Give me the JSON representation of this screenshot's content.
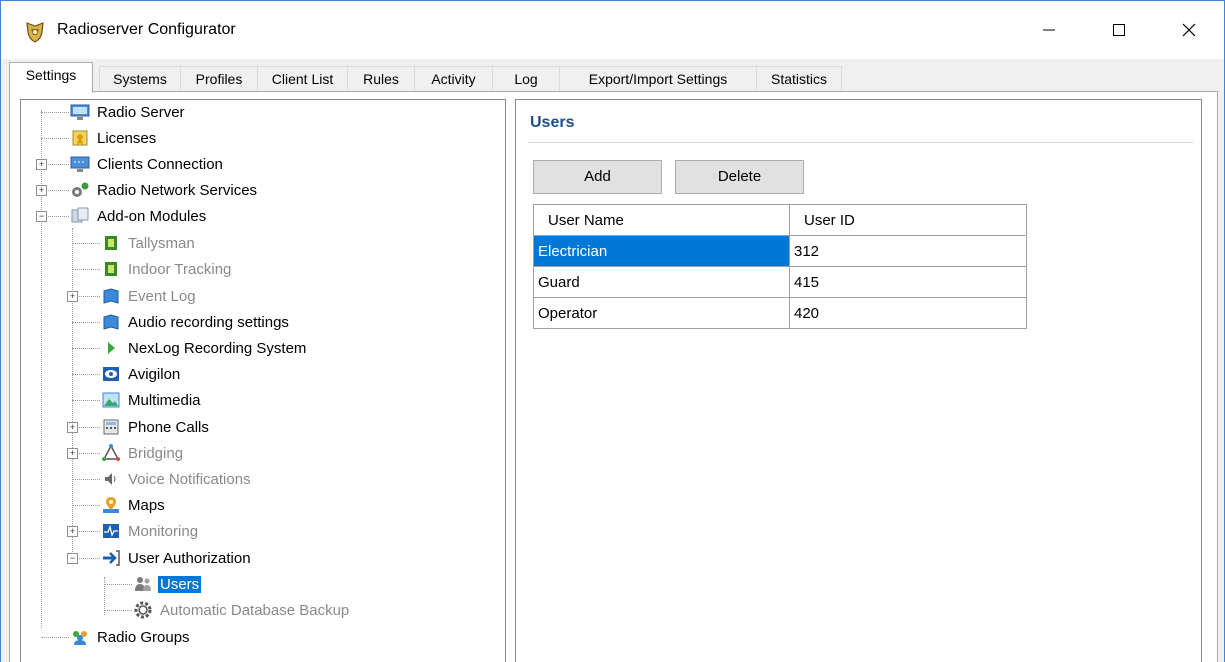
{
  "window": {
    "title": "Radioserver Configurator"
  },
  "tabs": [
    "Settings",
    "Systems",
    "Profiles",
    "Client List",
    "Rules",
    "Activity",
    "Log",
    "Export/Import Settings",
    "Statistics"
  ],
  "tree": [
    {
      "label": "Radio Server",
      "icon": "monitor-icon"
    },
    {
      "label": "Licenses",
      "icon": "license-icon"
    },
    {
      "label": "Clients Connection",
      "icon": "network-icon"
    },
    {
      "label": "Radio Network Services",
      "icon": "services-icon"
    },
    {
      "label": "Add-on Modules",
      "icon": "modules-icon"
    },
    {
      "label": "Tallysman",
      "icon": "chip-icon"
    },
    {
      "label": "Indoor Tracking",
      "icon": "chip-icon"
    },
    {
      "label": "Event Log",
      "icon": "book-icon"
    },
    {
      "label": "Audio recording settings",
      "icon": "book-icon"
    },
    {
      "label": "NexLog Recording System",
      "icon": "play-icon"
    },
    {
      "label": "Avigilon",
      "icon": "eye-icon"
    },
    {
      "label": "Multimedia",
      "icon": "picture-icon"
    },
    {
      "label": "Phone Calls",
      "icon": "phone-icon"
    },
    {
      "label": "Bridging",
      "icon": "bridge-icon"
    },
    {
      "label": "Voice Notifications",
      "icon": "speaker-icon"
    },
    {
      "label": "Maps",
      "icon": "map-icon"
    },
    {
      "label": "Monitoring",
      "icon": "pulse-icon"
    },
    {
      "label": "User Authorization",
      "icon": "login-arrow-icon"
    },
    {
      "label": "Users",
      "icon": "users-icon"
    },
    {
      "label": "Automatic Database Backup",
      "icon": "gear-icon"
    },
    {
      "label": "Radio Groups",
      "icon": "group-icon"
    }
  ],
  "panel": {
    "title": "Users",
    "add_label": "Add",
    "delete_label": "Delete",
    "columns": [
      "User Name",
      "User ID"
    ],
    "rows": [
      {
        "name": "Electrician",
        "id": "312"
      },
      {
        "name": "Guard",
        "id": "415"
      },
      {
        "name": "Operator",
        "id": "420"
      }
    ]
  },
  "colors": {
    "selection": "#0078d7",
    "section_title": "#1e4e8c",
    "window_border": "#3c86d6"
  }
}
